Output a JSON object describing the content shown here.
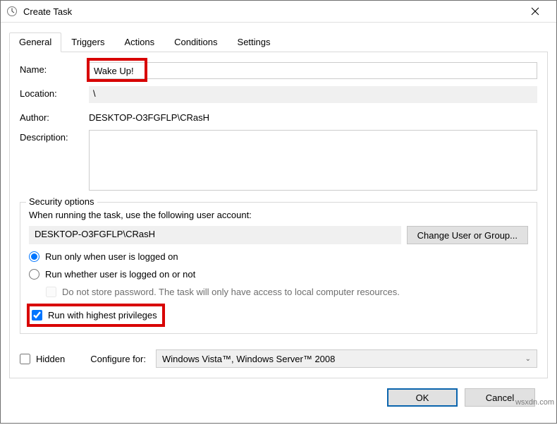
{
  "window": {
    "title": "Create Task"
  },
  "tabs": {
    "general": "General",
    "triggers": "Triggers",
    "actions": "Actions",
    "conditions": "Conditions",
    "settings": "Settings"
  },
  "fields": {
    "name_label": "Name:",
    "name_value": "Wake Up!",
    "location_label": "Location:",
    "location_value": "\\",
    "author_label": "Author:",
    "author_value": "DESKTOP-O3FGFLP\\CRasH",
    "description_label": "Description:",
    "description_value": ""
  },
  "security": {
    "legend": "Security options",
    "prompt": "When running the task, use the following user account:",
    "account": "DESKTOP-O3FGFLP\\CRasH",
    "change_user_btn": "Change User or Group...",
    "radio_logged_on": "Run only when user is logged on",
    "radio_whether": "Run whether user is logged on or not",
    "nostore": "Do not store password.  The task will only have access to local computer resources.",
    "highest_priv": "Run with highest privileges"
  },
  "bottom": {
    "hidden": "Hidden",
    "configure_for": "Configure for:",
    "configure_value": "Windows Vista™, Windows Server™ 2008"
  },
  "buttons": {
    "ok": "OK",
    "cancel": "Cancel"
  },
  "watermark": "wsxdn.com"
}
